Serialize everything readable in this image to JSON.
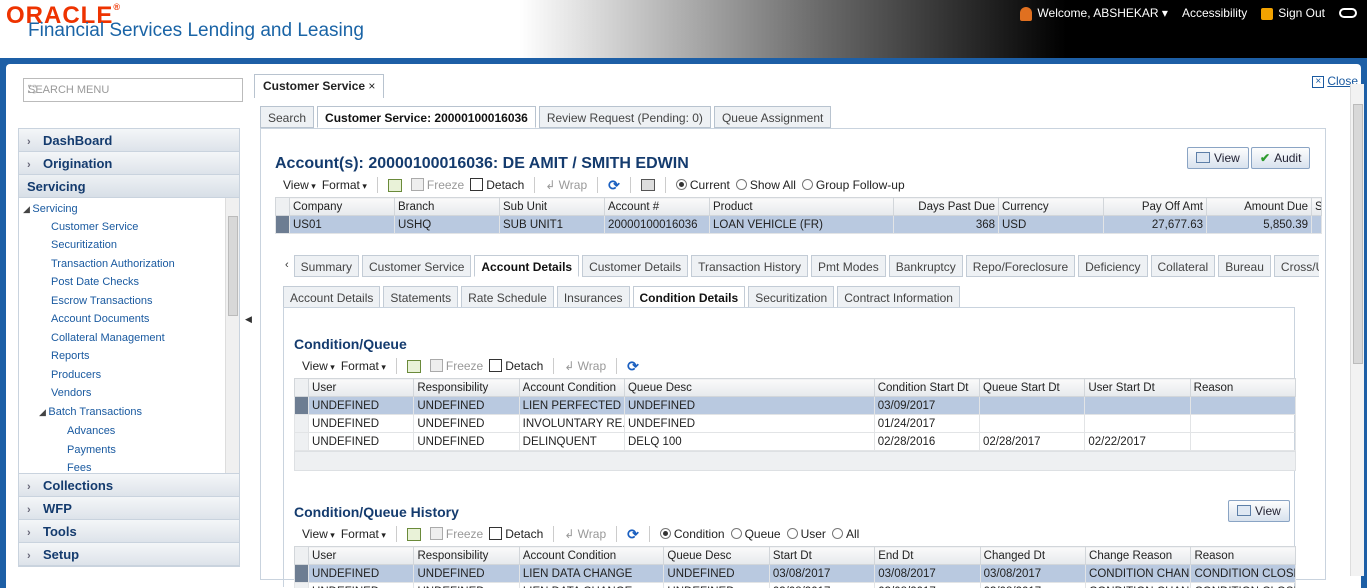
{
  "header": {
    "logo": "ORACLE",
    "logo_mark": "®",
    "product": "Financial Services Lending and Leasing",
    "welcome": "Welcome, ABSHEKAR",
    "accessibility": "Accessibility",
    "signout": "Sign Out"
  },
  "leftnav": {
    "search_placeholder": "SEARCH MENU",
    "sections": [
      "DashBoard",
      "Origination",
      "Servicing",
      "Collections",
      "WFP",
      "Tools",
      "Setup"
    ],
    "servicing_root": "Servicing",
    "items": [
      "Customer Service",
      "Securitization",
      "Transaction Authorization",
      "Post Date Checks",
      "Escrow Transactions",
      "Account Documents",
      "Collateral Management",
      "Reports",
      "Producers",
      "Vendors"
    ],
    "batch": "Batch Transactions",
    "batch_items": [
      "Advances",
      "Payments",
      "Fees"
    ]
  },
  "main": {
    "tab_title": "Customer Service",
    "close": "Close",
    "subtabs": [
      "Search",
      "Customer Service: 20000100016036",
      "Review Request (Pending: 0)",
      "Queue Assignment"
    ],
    "account_title": "Account(s): 20000100016036: DE AMIT / SMITH EDWIN",
    "view_btn": "View",
    "audit_btn": "Audit",
    "toolbar": {
      "view": "View",
      "format": "Format",
      "freeze": "Freeze",
      "detach": "Detach",
      "wrap": "Wrap",
      "current": "Current",
      "show_all": "Show All",
      "group_followup": "Group Follow-up"
    },
    "acct_columns": [
      "Company",
      "Branch",
      "Sub Unit",
      "Account #",
      "Product",
      "Days Past Due",
      "Currency",
      "Pay Off Amt",
      "Amount Due",
      "S"
    ],
    "acct_rows": [
      [
        "US01",
        "USHQ",
        "SUB UNIT1",
        "20000100016036",
        "LOAN VEHICLE (FR)",
        "368",
        "USD",
        "27,677.63",
        "5,850.39",
        ""
      ]
    ],
    "main_tabs": [
      "Summary",
      "Customer Service",
      "Account Details",
      "Customer Details",
      "Transaction History",
      "Pmt Modes",
      "Bankruptcy",
      "Repo/Foreclosure",
      "Deficiency",
      "Collateral",
      "Bureau",
      "Cross/Up Sell Act"
    ],
    "detail_tabs": [
      "Account Details",
      "Statements",
      "Rate Schedule",
      "Insurances",
      "Condition Details",
      "Securitization",
      "Contract Information"
    ],
    "cq": {
      "title": "Condition/Queue",
      "columns": [
        "User",
        "Responsibility",
        "Account Condition",
        "Queue Desc",
        "Condition Start Dt",
        "Queue Start Dt",
        "User Start Dt",
        "Reason"
      ],
      "rows": [
        [
          "UNDEFINED",
          "UNDEFINED",
          "LIEN PERFECTED",
          "UNDEFINED",
          "03/09/2017",
          "",
          "",
          ""
        ],
        [
          "UNDEFINED",
          "UNDEFINED",
          "INVOLUNTARY RE...",
          "UNDEFINED",
          "01/24/2017",
          "",
          "",
          ""
        ],
        [
          "UNDEFINED",
          "UNDEFINED",
          "DELINQUENT",
          "DELQ 100",
          "02/28/2016",
          "02/28/2017",
          "02/22/2017",
          ""
        ]
      ]
    },
    "cqh": {
      "title": "Condition/Queue History",
      "radios": [
        "Condition",
        "Queue",
        "User",
        "All"
      ],
      "columns": [
        "User",
        "Responsibility",
        "Account Condition",
        "Queue Desc",
        "Start Dt",
        "End Dt",
        "Changed Dt",
        "Change Reason",
        "Reason"
      ],
      "rows": [
        [
          "UNDEFINED",
          "UNDEFINED",
          "LIEN DATA CHANGE",
          "UNDEFINED",
          "03/08/2017",
          "03/08/2017",
          "03/08/2017",
          "CONDITION CHAN...",
          "CONDITION CLOSE"
        ],
        [
          "UNDEFINED",
          "UNDEFINED",
          "LIEN DATA CHANGE",
          "UNDEFINED",
          "03/08/2017",
          "03/08/2017",
          "03/08/2017",
          "CONDITION CHAN...",
          "CONDITION CLOSE"
        ]
      ]
    }
  }
}
